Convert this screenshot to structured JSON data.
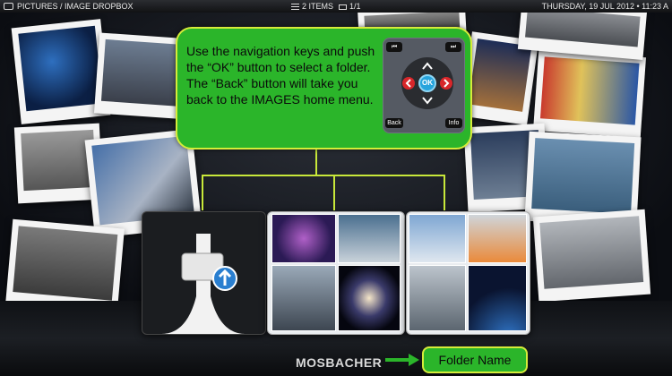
{
  "topbar": {
    "breadcrumb": "PICTURES / IMAGE DROPBOX",
    "items": "2 ITEMS",
    "page": "1/1",
    "datetime": "THURSDAY, 19 JUL 2012 • 11:23 A"
  },
  "help": {
    "text": "Use the navigation keys and push the “OK” button to select a folder. The “Back” button will take you back to the IMAGES home menu."
  },
  "remote": {
    "ok": "OK",
    "back": "Back",
    "info": "Info",
    "prev": "⏮",
    "next": "⏭"
  },
  "folder": {
    "title": "MOSBACHER",
    "tag": "Folder Name"
  },
  "colors": {
    "callout_green": "#2bb52a",
    "callout_border": "#d6ec3a",
    "ok_blue": "#27a4dd",
    "arrow_red": "#d8262a"
  },
  "icons": [
    "home-icon",
    "list-icon",
    "page-icon",
    "upload-icon",
    "arrow-right-icon"
  ]
}
